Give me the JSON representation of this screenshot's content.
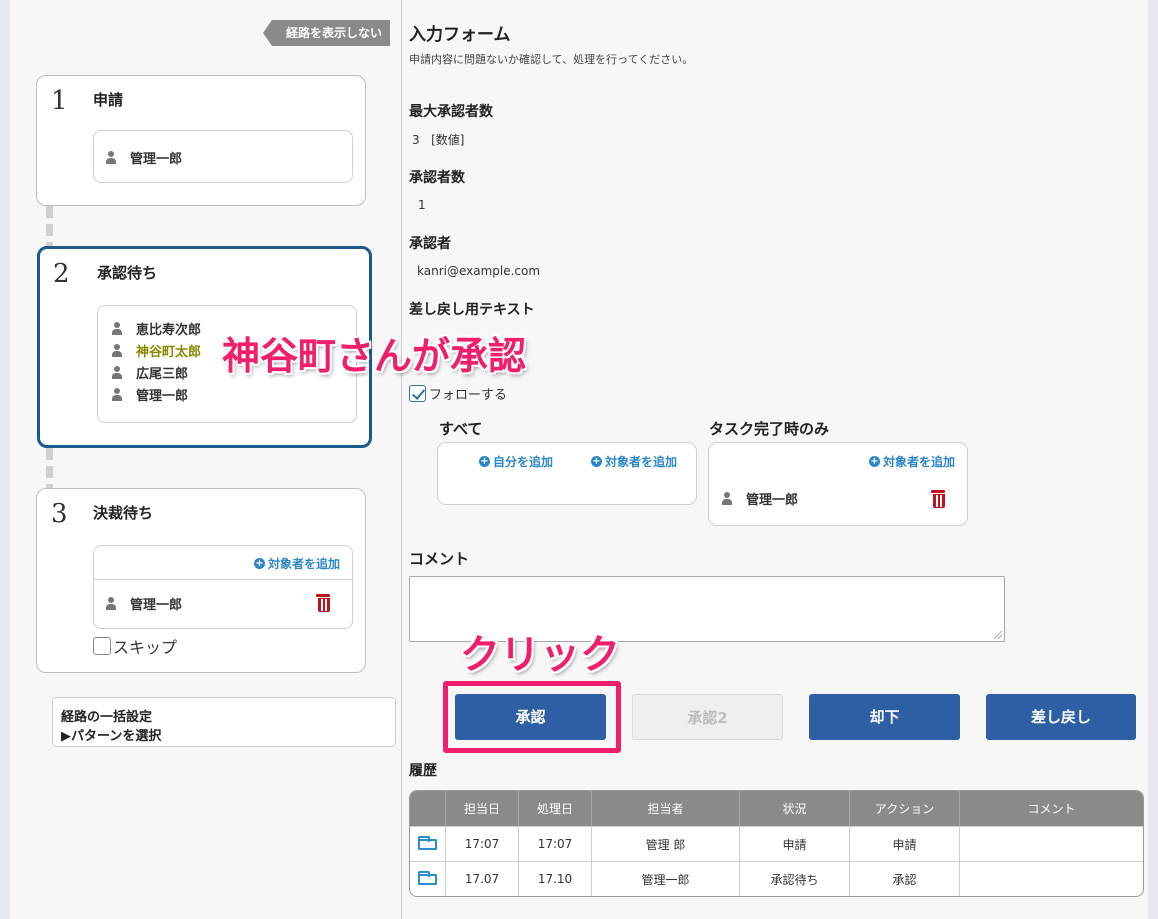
{
  "route_toggle_label": "経路を表示しない",
  "steps": [
    {
      "number": "1",
      "title": "申請",
      "approvers": [
        "管理一郎"
      ]
    },
    {
      "number": "2",
      "title": "承認待ち",
      "approvers": [
        "恵比寿次郎",
        "神谷町太郎",
        "広尾三郎",
        "管理一郎"
      ],
      "highlighted_approver": "神谷町太郎"
    },
    {
      "number": "3",
      "title": "決裁待ち",
      "add_label": "対象者を追加",
      "approvers": [
        "管理一郎"
      ],
      "skip_label": "スキップ"
    }
  ],
  "pattern": {
    "title": "経路の一括設定",
    "link": "▶パターンを選択"
  },
  "form": {
    "title": "入力フォーム",
    "description": "申請内容に問題ないか確認して、処理を行ってください。",
    "max_approvers_label": "最大承認者数",
    "max_approvers_value": "3",
    "max_approvers_unit": "[数値]",
    "approver_count_label": "承認者数",
    "approver_count_value": "1",
    "approver_label": "承認者",
    "approver_value": "kanri@example.com",
    "remand_text_label": "差し戻し用テキスト",
    "follow_label": "フォローする",
    "all_label": "すべて",
    "add_self_label": "自分を追加",
    "add_target_label": "対象者を追加",
    "task_done_label": "タスク完了時のみ",
    "task_done_add_label": "対象者を追加",
    "task_done_person": "管理一郎",
    "comment_label": "コメント"
  },
  "buttons": {
    "approve": "承認",
    "approve2": "承認2",
    "reject": "却下",
    "remand": "差し戻し"
  },
  "annotations": {
    "approved_by": "神谷町さんが承認",
    "click": "クリック"
  },
  "history": {
    "title": "履歴",
    "columns": [
      "",
      "担当日",
      "処理日",
      "担当者",
      "状況",
      "アクション",
      "コメント"
    ],
    "rows": [
      [
        "folder-icon",
        "17:07",
        "17:07",
        "管理 郎",
        "申請",
        "申請",
        ""
      ],
      [
        "folder-icon",
        "17.07",
        "17.10",
        "管理一郎",
        "承認待ち",
        "承認",
        ""
      ]
    ]
  },
  "colors": {
    "primary_button": "#2e5ea4",
    "active_step_border": "#1c5a8e",
    "annotation": "#f01e6b",
    "delete_icon": "#c0121c",
    "link": "#2c87c9"
  }
}
